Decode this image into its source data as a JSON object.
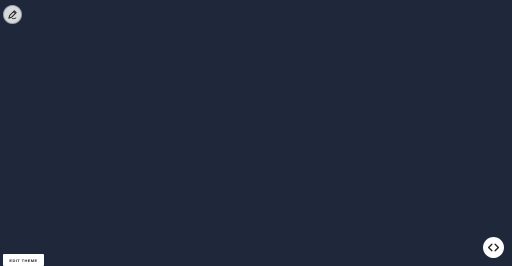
{
  "page": {
    "background": "#1f283a"
  },
  "controls": {
    "edit_fab_icon": "pencil-icon",
    "edit_theme_label": "EDIT THEME",
    "code_toggle_icon": "code-brackets-icon"
  },
  "colors": {
    "fab_bg": "#d7d8db",
    "button_bg": "#ffffff",
    "icon_dark": "#222222"
  }
}
